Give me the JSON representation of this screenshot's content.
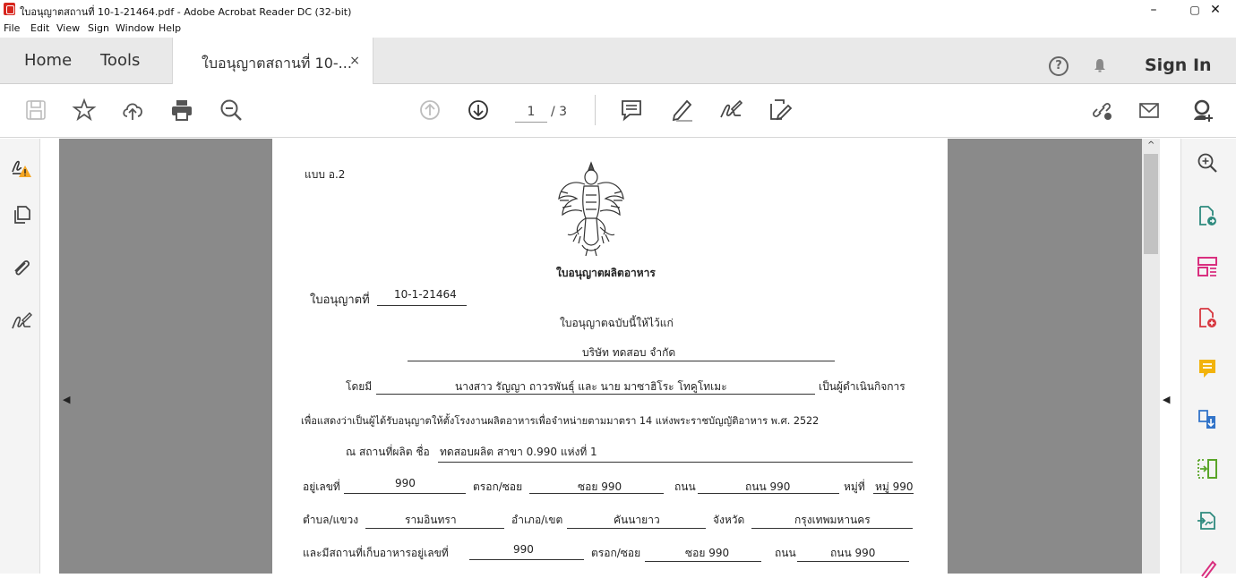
{
  "window": {
    "title": "ใบอนุญาตสถานที่ 10-1-21464.pdf - Adobe Acrobat Reader DC (32-bit)",
    "minimize": "–",
    "restore": "▢",
    "close": "✕"
  },
  "menu": [
    "File",
    "Edit",
    "View",
    "Sign",
    "Window",
    "Help"
  ],
  "tabs": {
    "home": "Home",
    "tools": "Tools",
    "document": "ใบอนุญาตสถานที่ 10-...",
    "close": "×"
  },
  "header": {
    "help": "?",
    "sign_in": "Sign In"
  },
  "toolbar": {
    "page_current": "1",
    "page_total": "/ 3"
  },
  "scroll": {
    "up_arrow": "^",
    "left_collapse": "◀",
    "right_collapse": "◀"
  },
  "document": {
    "form_code": "แบบ อ.2",
    "heading": "ใบอนุญาตผลิตอาหาร",
    "license_no_label": "ใบอนุญาตที่",
    "license_no": "10-1-21464",
    "issued_to_label": "ใบอนุญาตฉบับนี้ให้ไว้แก่",
    "company": "บริษัท ทดสอบ จำกัด",
    "by_label": "โดยมี",
    "operators": "นางสาว รัญญา ถาวรพันธุ์ และ นาย มาซาฮิโระ โทคูโทเมะ",
    "operator_suffix": "เป็นผู้ดำเนินกิจการ",
    "statement": "เพื่อแสดงว่าเป็นผู้ได้รับอนุญาตให้ตั้งโรงงานผลิตอาหารเพื่อจำหน่ายตามมาตรา 14 แห่งพระราชบัญญัติอาหาร พ.ศ. 2522",
    "site_label": "ณ สถานที่ผลิต ชื่อ",
    "site_name": "ทดสอบผลิต สาขา 0.990 แห่งที่ 1",
    "address_no_label": "อยู่เลขที่",
    "address_no": "990",
    "alley_label": "ตรอก/ซอย",
    "alley": "ซอย 990",
    "road_label": "ถนน",
    "road": "ถนน 990",
    "moo_label": "หมู่ที่",
    "moo": "หมู่ 990",
    "subdistrict_label": "ตำบล/แขวง",
    "subdistrict": "รามอินทรา",
    "district_label": "อำเภอ/เขต",
    "district": "คันนายาว",
    "province_label": "จังหวัด",
    "province": "กรุงเทพมหานคร",
    "storage_label": "และมีสถานที่เก็บอาหารอยู่เลขที่",
    "storage_no": "990",
    "storage_alley_label": "ตรอก/ซอย",
    "storage_alley": "ซอย 990",
    "storage_road_label": "ถนน",
    "storage_road": "ถนน 990"
  }
}
